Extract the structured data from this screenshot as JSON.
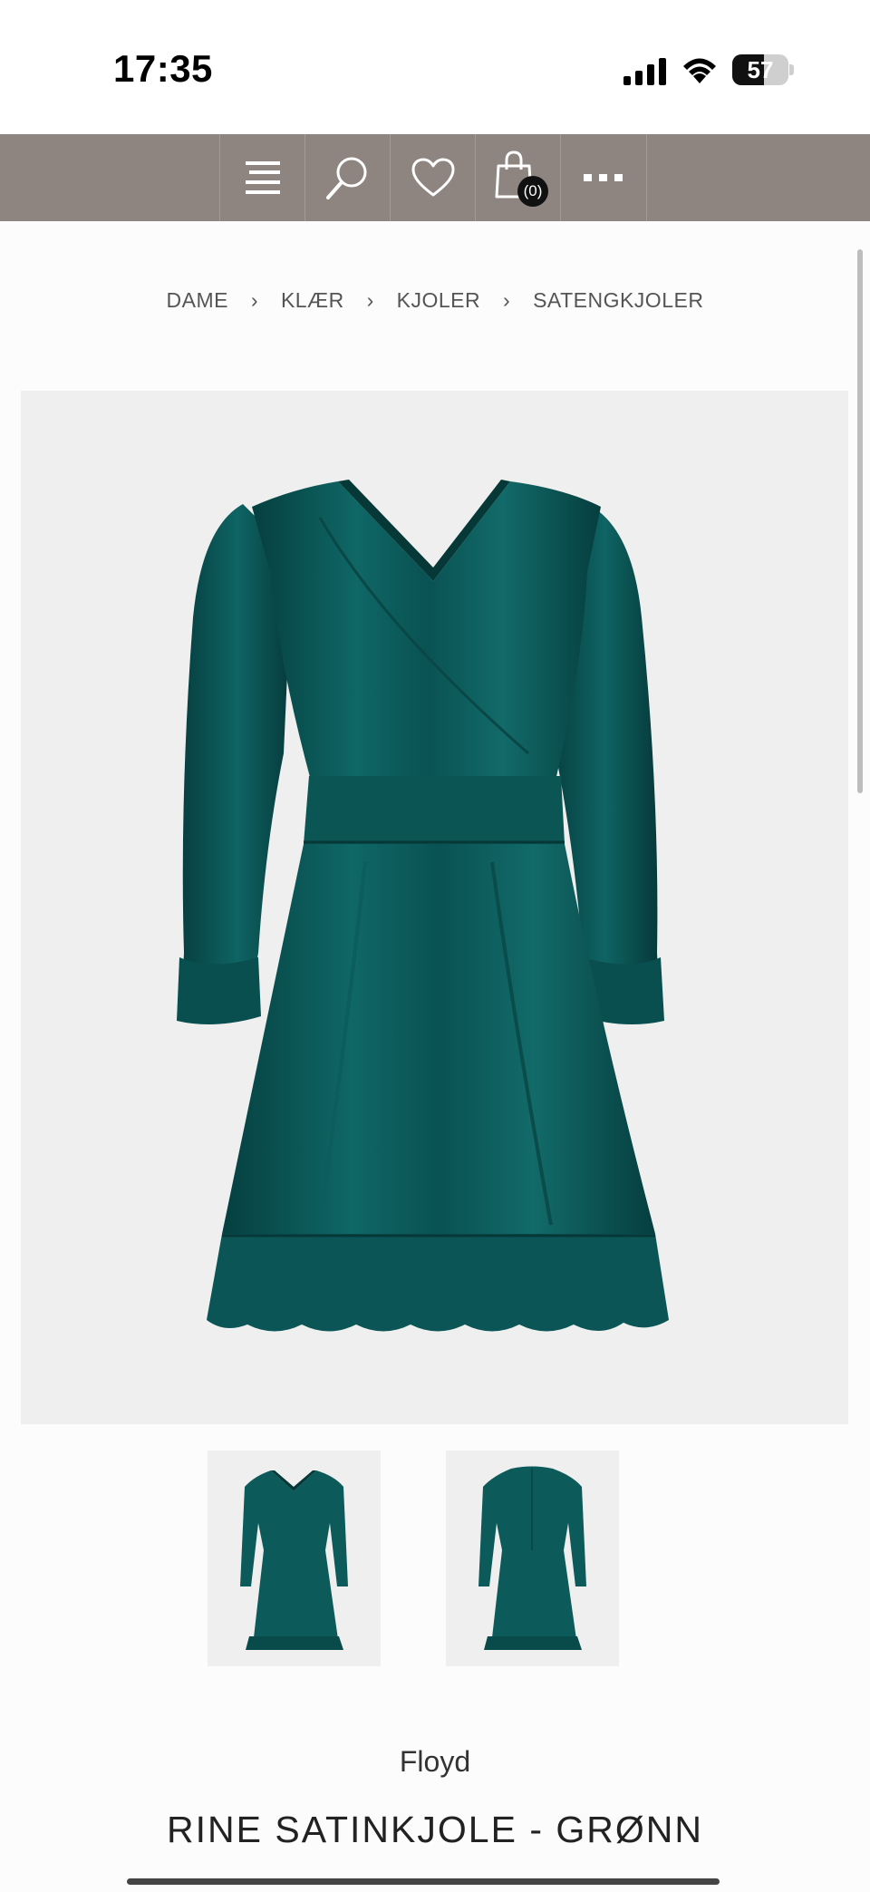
{
  "status": {
    "time": "17:35",
    "battery": "57",
    "battery_level": 0.57
  },
  "nav": {
    "cart_count": "(0)"
  },
  "breadcrumb": [
    "DAME",
    "KLÆR",
    "KJOLER",
    "SATENGKJOLER"
  ],
  "product": {
    "brand": "Floyd",
    "title": "RINE SATINKJOLE - GRØNN"
  },
  "colors": {
    "nav_bg": "#8e8580",
    "dress": "#0d5a5a",
    "image_bg": "#efefef"
  },
  "icons": [
    "menu-icon",
    "search-icon",
    "heart-icon",
    "shopping-bag-icon",
    "more-icon"
  ]
}
